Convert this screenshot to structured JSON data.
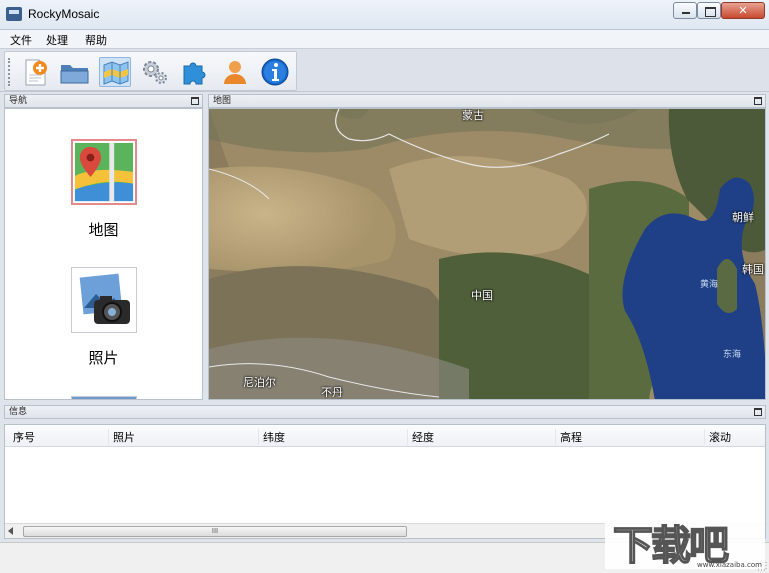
{
  "window": {
    "title": "RockyMosaic",
    "close_glyph": "✕"
  },
  "menu": [
    {
      "label": "文件"
    },
    {
      "label": "处理"
    },
    {
      "label": "帮助"
    }
  ],
  "toolbar": {
    "buttons": [
      {
        "icon": "new-project-icon"
      },
      {
        "icon": "open-folder-icon"
      },
      {
        "icon": "map-icon"
      },
      {
        "icon": "settings-gears-icon"
      },
      {
        "icon": "plugin-puzzle-icon"
      },
      {
        "icon": "user-icon"
      },
      {
        "icon": "info-icon"
      }
    ]
  },
  "nav": {
    "title": "导航",
    "items": [
      {
        "label": "地图",
        "icon": "map-location-icon",
        "selected": true
      },
      {
        "label": "照片",
        "icon": "photo-camera-icon",
        "selected": false
      }
    ]
  },
  "map": {
    "title": "地图",
    "labels": {
      "mongolia": "蒙古",
      "north_korea": "朝鲜",
      "south_korea": "韩国",
      "yellow_sea": "黄海",
      "east_sea": "东海",
      "china": "中国",
      "nepal": "尼泊尔",
      "bhutan": "不丹"
    },
    "colors": {
      "land": "#9b8a67",
      "desert": "#c9b48a",
      "forest": "#4e5f3a",
      "sea": "#1f3f86"
    }
  },
  "info": {
    "title": "信息",
    "columns": [
      "序号",
      "照片",
      "纬度",
      "经度",
      "高程",
      "滚动"
    ],
    "rows": [],
    "scroll_thumb_glyph": "III"
  },
  "watermark": {
    "text": "下载吧",
    "domain": "www.xiazaiba.com"
  }
}
